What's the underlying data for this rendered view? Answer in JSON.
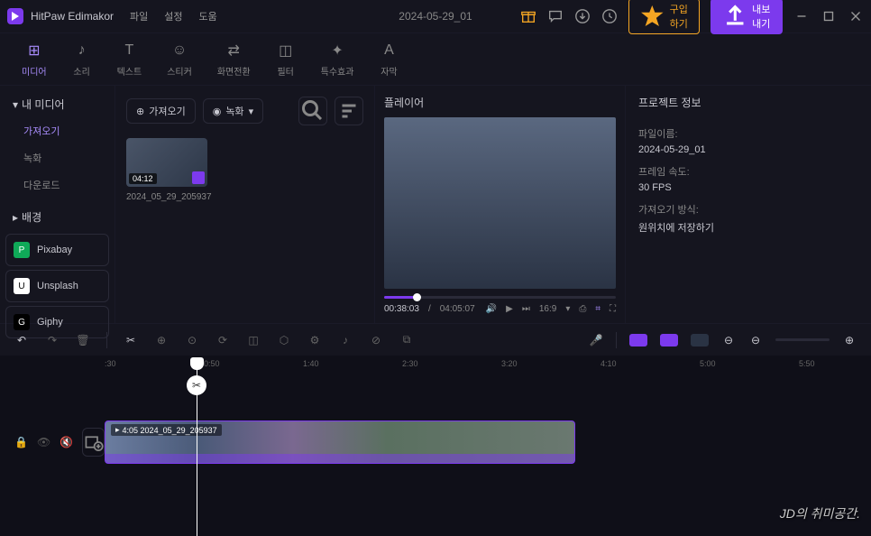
{
  "titlebar": {
    "app_name": "HitPaw Edimakor",
    "menu": [
      "파일",
      "설정",
      "도움"
    ],
    "doc_title": "2024-05-29_01",
    "buy_label": "구입하기",
    "export_label": "내보내기"
  },
  "tools": [
    {
      "label": "미디어",
      "glyph": "⊞"
    },
    {
      "label": "소리",
      "glyph": "♪"
    },
    {
      "label": "텍스트",
      "glyph": "T"
    },
    {
      "label": "스티커",
      "glyph": "☺"
    },
    {
      "label": "화면전환",
      "glyph": "⇄"
    },
    {
      "label": "필터",
      "glyph": "◫"
    },
    {
      "label": "특수효과",
      "glyph": "✦"
    },
    {
      "label": "자막",
      "glyph": "A"
    }
  ],
  "left": {
    "my_media": "내 미디어",
    "subs": [
      "가져오기",
      "녹화",
      "다운로드"
    ],
    "background": "배경",
    "providers": [
      {
        "name": "Pixabay",
        "color": "#0fa958"
      },
      {
        "name": "Unsplash",
        "color": "#ffffff"
      },
      {
        "name": "Giphy",
        "color": "#000000"
      }
    ]
  },
  "media": {
    "import_label": "가져오기",
    "record_label": "녹화",
    "clip": {
      "duration": "04:12",
      "name": "2024_05_29_205937"
    }
  },
  "player": {
    "title": "플레이어",
    "current": "00:38:03",
    "total": "04:05:07",
    "ratio": "16:9"
  },
  "info": {
    "title": "프로젝트 정보",
    "filename_label": "파일이름:",
    "filename": "2024-05-29_01",
    "fps_label": "프레임 속도:",
    "fps": "30 FPS",
    "import_label": "가져오기 방식:",
    "import_mode": "원위치에 저장하기"
  },
  "timeline": {
    "marks": [
      ":30",
      "0:50",
      "1:40",
      "2:30",
      "3:20",
      "4:10",
      "5:00",
      "5:50"
    ],
    "clip_label": "4:05 2024_05_29_205937"
  },
  "watermark": "JD의 취미공간."
}
